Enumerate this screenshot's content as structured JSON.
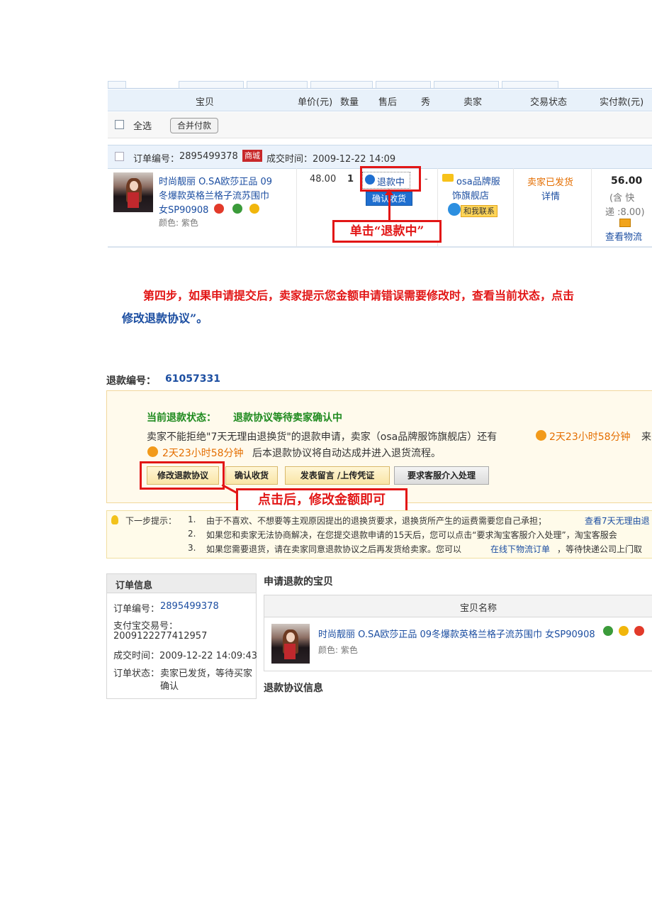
{
  "list": {
    "headers": [
      "宝贝",
      "单价(元)",
      "数量",
      "售后",
      "秀",
      "卖家",
      "交易状态",
      "实付款(元)"
    ],
    "select_all": "全选",
    "merge_pay": "合并付款",
    "order_no_label": "订单编号：",
    "order_no": "2895499378",
    "mall_badge": "商城",
    "deal_time": "成交时间：2009-12-22 14:09",
    "item_title_1": "时尚靓丽 O.SA欧莎正品 09",
    "item_title_2": "冬爆款英格兰格子流苏围巾",
    "item_title_3": "女SP90908",
    "item_color": "颜色: 紫色",
    "price": "48.00",
    "qty": "1",
    "refunding": "退款中",
    "dash": "-",
    "confirm_receipt": "确认收货",
    "seller_1": "osa品牌服",
    "seller_2": "饰旗舰店",
    "contact": "和我联系",
    "trade_status": "卖家已发货",
    "detail": "详情",
    "paid": "56.00",
    "shipping_1": "(含 快",
    "shipping_2": "递 :8.00)",
    "view_logistics": "查看物流",
    "annotation": "单击“退款中”"
  },
  "instruction": {
    "line1": "第四步，如果申请提交后，卖家提示您金额申请错误需要修改时，查看当前状态，点击",
    "line2": "修改退款协议”。"
  },
  "refund": {
    "refund_no_label": "退款编号：",
    "refund_no": "61057331",
    "status_label": "当前退款状态：",
    "status_value": "退款协议等待卖家确认中",
    "desc_1a": "卖家不能拒绝\"7天无理由退换货\"的退款申请，卖家（osa品牌服饰旗舰店）还有",
    "desc_1b": "2天23小时58分钟",
    "desc_1c": "来",
    "desc_2a": "2天23小时58分钟",
    "desc_2b": "后本退款协议将自动达成并进入退货流程。",
    "actions": [
      "修改退款协议",
      "确认收货",
      "发表留言 /上传凭证",
      "要求客服介入处理"
    ],
    "annotation": "点击后，修改金额即可",
    "tip_label": "下一步提示：",
    "tips": [
      {
        "num": "1.",
        "text": "由于不喜欢、不想要等主观原因提出的退换货要求，退换货所产生的运费需要您自己承担；",
        "link": "查看7天无理由退"
      },
      {
        "num": "2.",
        "text": "如果您和卖家无法协商解决，在您提交退款申请的15天后，您可以点击“要求淘宝客服介入处理”，淘宝客服会",
        "link": ""
      },
      {
        "num": "3.",
        "text": "如果您需要退货，请在卖家同意退款协议之后再发货给卖家。您可以",
        "link": "在线下物流订单",
        "after": "，等待快递公司上门取"
      }
    ],
    "order_info": {
      "title": "订单信息",
      "order_no_label": "订单编号：",
      "order_no": "2895499378",
      "alipay_label": "支付宝交易号：",
      "alipay_no": "2009122277412957",
      "deal_time": "成交时间：2009-12-22 14:09:43",
      "status_label": "订单状态：",
      "status_1": "卖家已发货，等待买家",
      "status_2": "确认"
    },
    "item_section_title": "申请退款的宝贝",
    "item_col": "宝贝名称",
    "item_name": "时尚靓丽 O.SA欧莎正品 09冬爆款英格兰格子流苏围巾 女SP90908",
    "item_color": "颜色: 紫色",
    "agreement_title": "退款协议信息"
  },
  "colors": {
    "accent_red": "#e21616",
    "link_blue": "#1c4ea1",
    "orange": "#e46e00",
    "status_green": "#1e8a1e"
  }
}
